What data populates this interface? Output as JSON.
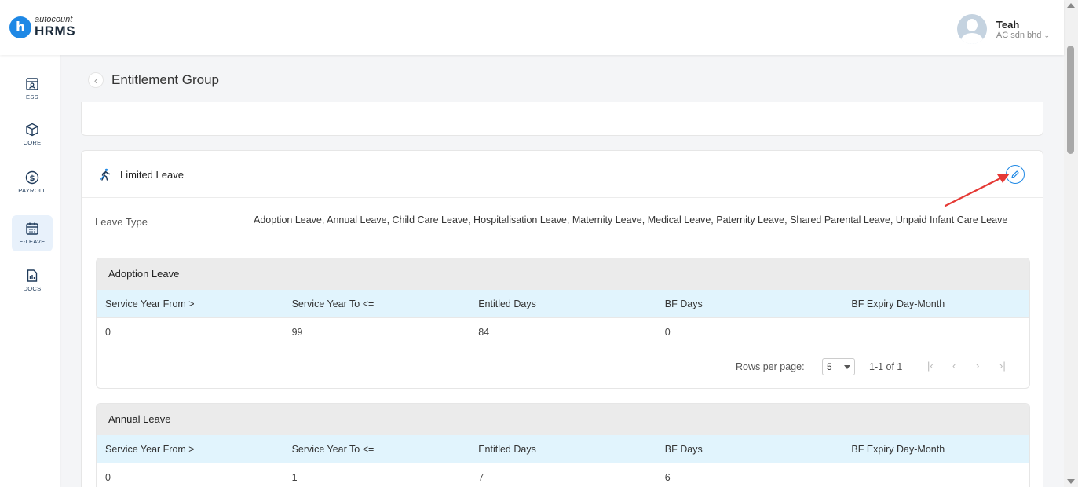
{
  "app": {
    "logo_small": "autocount",
    "logo_big": "HRMS",
    "logo_letter": "h"
  },
  "user": {
    "name": "Teah",
    "company": "AC sdn bhd"
  },
  "sidebar": {
    "items": [
      {
        "label": "ESS",
        "icon": "ess-icon"
      },
      {
        "label": "CORE",
        "icon": "core-icon"
      },
      {
        "label": "PAYROLL",
        "icon": "payroll-icon"
      },
      {
        "label": "E-LEAVE",
        "icon": "calendar-icon"
      },
      {
        "label": "DOCS",
        "icon": "docs-icon"
      }
    ]
  },
  "page": {
    "title": "Entitlement Group",
    "back_glyph": "‹"
  },
  "limited_leave": {
    "title": "Limited Leave",
    "leave_type_label": "Leave Type",
    "leave_type_value": "Adoption Leave, Annual Leave, Child Care Leave, Hospitalisation Leave, Maternity Leave, Medical Leave, Paternity Leave, Shared Parental Leave, Unpaid Infant Care Leave"
  },
  "table_headers": [
    "Service Year From >",
    "Service Year To <=",
    "Entitled Days",
    "BF Days",
    "BF Expiry Day-Month"
  ],
  "adoption": {
    "title": "Adoption Leave",
    "rows": [
      [
        "0",
        "99",
        "84",
        "0",
        ""
      ]
    ],
    "rows_per_page_label": "Rows per page:",
    "rows_per_page": "5",
    "range": "1-1 of 1"
  },
  "annual": {
    "title": "Annual Leave",
    "rows": [
      [
        "0",
        "1",
        "7",
        "6",
        ""
      ]
    ]
  },
  "pagination": {
    "first": "|‹",
    "prev": "‹",
    "next": "›",
    "last": "›|"
  },
  "colors": {
    "accent": "#1e88e5",
    "arrow": "#e53935",
    "table_header": "#e1f4fd"
  }
}
